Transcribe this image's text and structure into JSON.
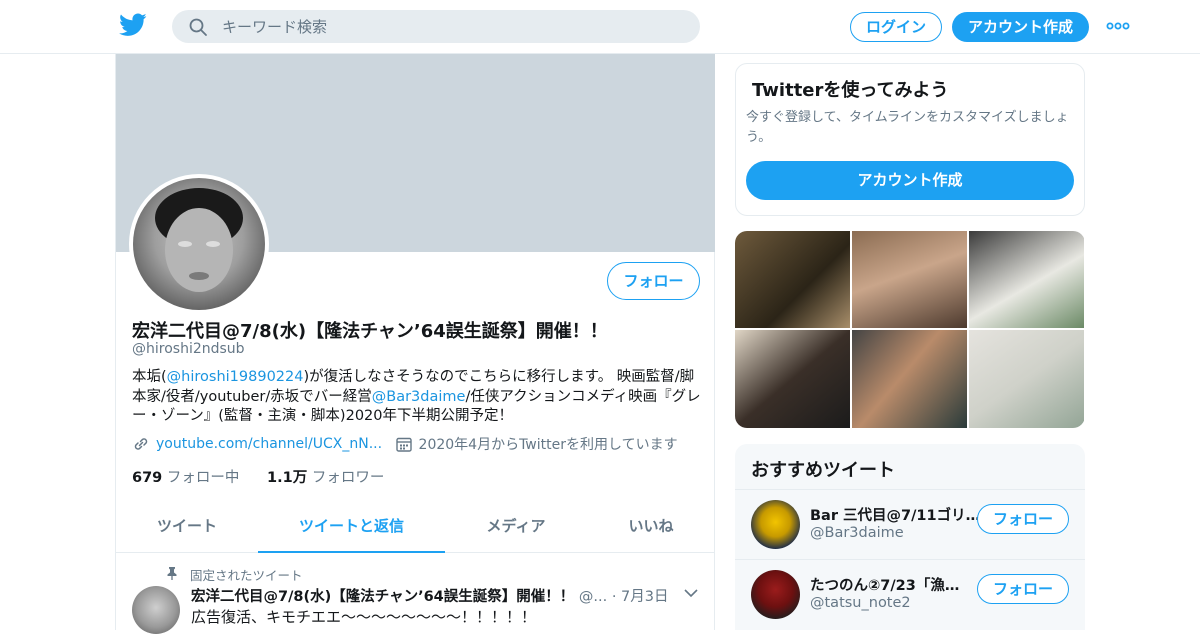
{
  "topbar": {
    "search_placeholder": "キーワード検索",
    "login_label": "ログイン",
    "signup_label": "アカウント作成"
  },
  "profile": {
    "follow_label": "フォロー",
    "name": "宏洋二代目@7/8(水)【隆法チャン’64誤生誕祭】開催！！",
    "handle": "@hiroshi2ndsub",
    "bio": {
      "part1": "本垢(",
      "mention1": "@hiroshi19890224",
      "part2": ")が復活しなさそうなのでこちらに移行します。 映画監督/脚本家/役者/youtuber/赤坂でバー経営",
      "mention2": "@Bar3daime",
      "part3": "/任侠アクションコメディ映画『グレー・ゾーン』(監督・主演・脚本)2020年下半期公開予定！"
    },
    "link": "youtube.com/channel/UCX_nN...",
    "joined": "2020年4月からTwitterを利用しています",
    "following_count": "679",
    "following_label": "フォロー中",
    "followers_count": "1.1万",
    "followers_label": "フォロワー"
  },
  "tabs": [
    {
      "label": "ツイート"
    },
    {
      "label": "ツイートと返信"
    },
    {
      "label": "メディア"
    },
    {
      "label": "いいね"
    }
  ],
  "pinned_tweet": {
    "pinned_label": "固定されたツイート",
    "author": "宏洋二代目@7/8(水)【隆法チャン’64誤生誕祭】開催！！",
    "handle_date": "@... · 7月3日",
    "text": "広告復活、キモチエエ〜〜〜〜〜〜〜〜！！！！！"
  },
  "signup_card": {
    "title": "Twitterを使ってみよう",
    "description": "今すぐ登録して、タイムラインをカスタマイズしましょう。",
    "button_label": "アカウント作成"
  },
  "recommended": {
    "title": "おすすめツイート",
    "items": [
      {
        "name": "Bar 三代目@7/11ゴリ…",
        "handle": "@Bar3daime",
        "follow_label": "フォロー"
      },
      {
        "name": "たつのん②7/23「漁…",
        "handle": "@tatsu_note2",
        "follow_label": "フォロー"
      }
    ]
  },
  "colors": {
    "accent": "#1da1f2",
    "banner": "#ccd6dd",
    "secondary_text": "#657786"
  }
}
